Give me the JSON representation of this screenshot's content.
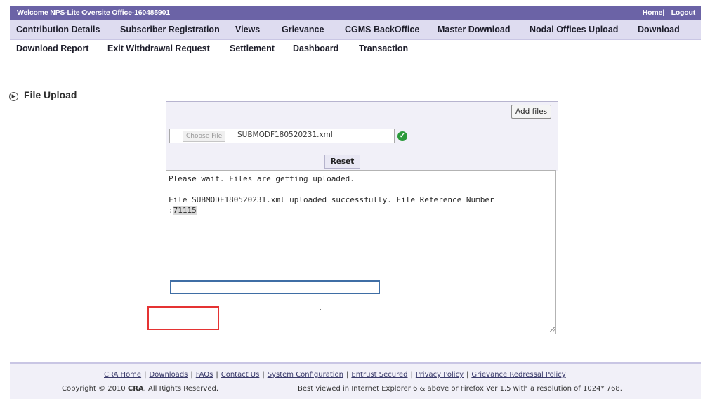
{
  "topbar": {
    "welcome": "Welcome NPS-Lite Oversite Office-160485901",
    "home": "Home",
    "separator": "|",
    "logout": "Logout"
  },
  "menu_row1": [
    {
      "label": "Contribution Details"
    },
    {
      "label": "Subscriber Registration"
    },
    {
      "label": "Views"
    },
    {
      "label": "Grievance"
    },
    {
      "label": "CGMS BackOffice"
    },
    {
      "label": "Master Download"
    },
    {
      "label": "Nodal Offices Upload"
    },
    {
      "label": "Download"
    }
  ],
  "menu_row2": [
    {
      "label": "Download Report"
    },
    {
      "label": "Exit Withdrawal Request"
    },
    {
      "label": "Settlement"
    },
    {
      "label": "Dashboard"
    },
    {
      "label": "Transaction"
    }
  ],
  "section": {
    "title": "File Upload"
  },
  "upload": {
    "add_files_label": "Add files",
    "choose_file_label": "Choose File",
    "file_name": "SUBMODF180520231.xml",
    "reset_label": "Reset"
  },
  "log": {
    "line1": "Please wait. Files are getting uploaded.",
    "line2": "File SUBMODF180520231.xml uploaded successfully. File Reference Number",
    "line3_prefix": ":",
    "reference_number": "71115"
  },
  "footer": {
    "links": [
      {
        "label": "CRA Home"
      },
      {
        "label": "Downloads"
      },
      {
        "label": "FAQs"
      },
      {
        "label": "Contact Us"
      },
      {
        "label": "System Configuration"
      },
      {
        "label": "Entrust Secured"
      },
      {
        "label": "Privacy Policy"
      },
      {
        "label": "Grievance Redressal Policy"
      }
    ],
    "copyright_prefix": "Copyright © 2010 ",
    "copyright_brand": "CRA",
    "copyright_suffix": ". All Rights Reserved.",
    "best_viewed": "Best viewed in Internet Explorer 6 & above or Firefox Ver 1.5 with a resolution of 1024* 768."
  },
  "colors": {
    "topbar": "#6b63a6",
    "menu_bg": "#dedcf0",
    "success": "#2a9a3a",
    "annotation_blue": "#3f6ea5",
    "annotation_red": "#e53333"
  }
}
